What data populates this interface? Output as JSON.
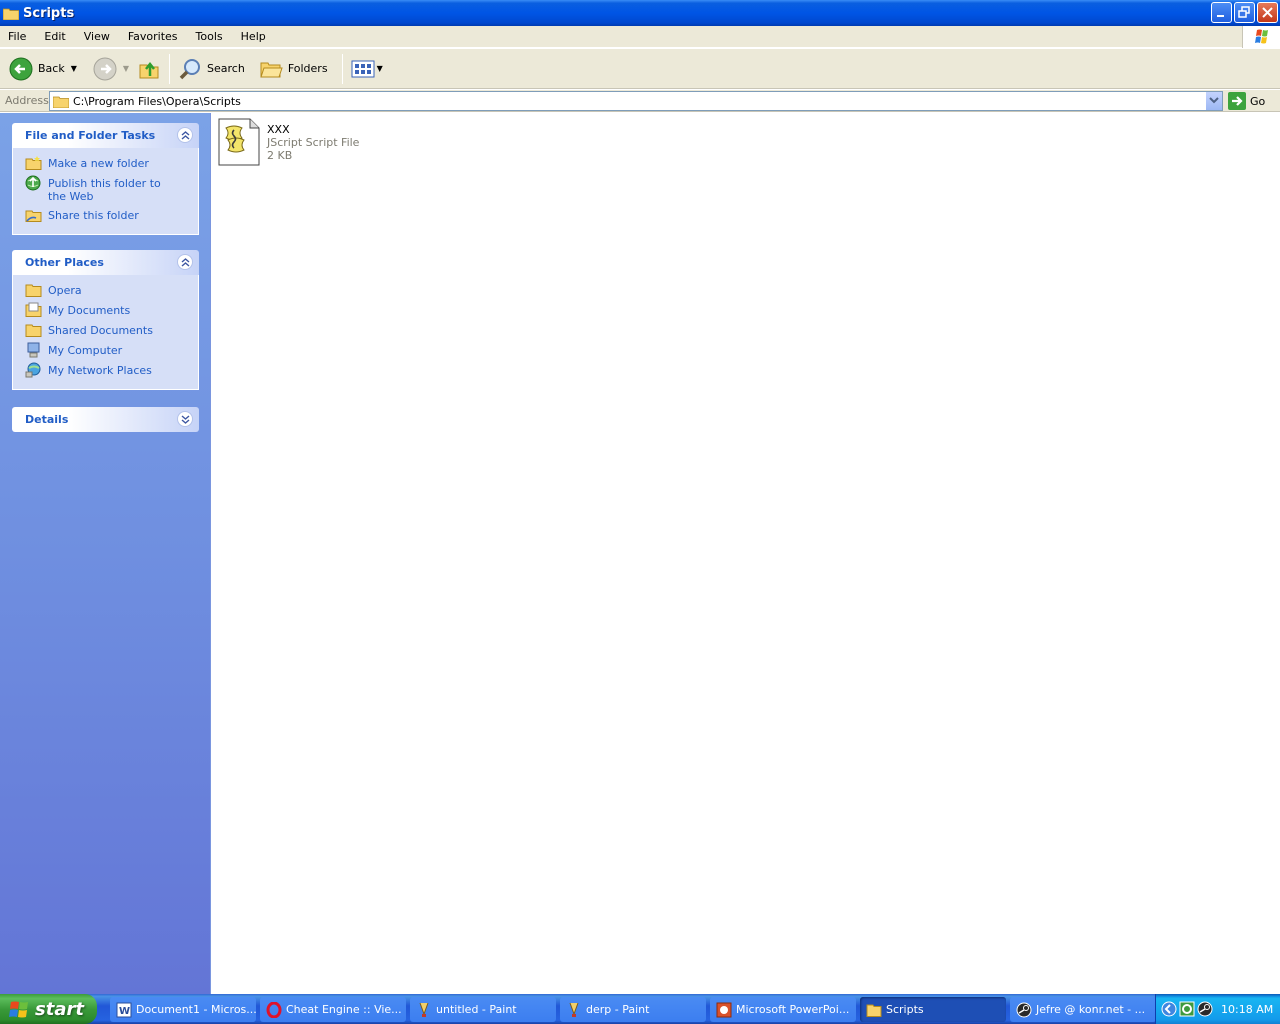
{
  "window": {
    "title": "Scripts"
  },
  "menu": [
    "File",
    "Edit",
    "View",
    "Favorites",
    "Tools",
    "Help"
  ],
  "toolbar": {
    "back_label": "Back",
    "search_label": "Search",
    "folders_label": "Folders"
  },
  "address": {
    "label": "Address",
    "value": "C:\\Program Files\\Opera\\Scripts",
    "go_label": "Go"
  },
  "taskpane": {
    "file_tasks": {
      "title": "File and Folder Tasks",
      "items": [
        "Make a new folder",
        "Publish this folder to the Web",
        "Share this folder"
      ]
    },
    "other_places": {
      "title": "Other Places",
      "items": [
        "Opera",
        "My Documents",
        "Shared Documents",
        "My Computer",
        "My Network Places"
      ]
    },
    "details": {
      "title": "Details"
    }
  },
  "files": [
    {
      "name": "XXX",
      "type": "JScript Script File",
      "size": "2 KB"
    }
  ],
  "taskbar": {
    "start_label": "start",
    "tasks": [
      "Document1 - Micros...",
      "Cheat Engine :: Vie...",
      "untitled - Paint",
      "derp - Paint",
      "Microsoft PowerPoi...",
      "Scripts",
      "Jefre @ konr.net - ..."
    ],
    "clock": "10:18 AM"
  }
}
